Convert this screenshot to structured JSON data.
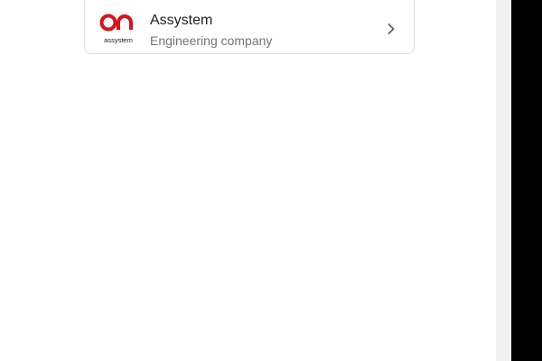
{
  "result": {
    "logo_text": "assystem",
    "logo_icon": "assystem-logo",
    "name": "Assystem",
    "subtitle": "Engineering company",
    "chevron_icon": "chevron-right-icon"
  },
  "colors": {
    "logo_red": "#d7141a",
    "title_text": "#202124",
    "subtitle_text": "#70757a",
    "card_border": "#dadce0",
    "scrollbar_track": "#f1f1f1",
    "right_edge": "#000000"
  }
}
